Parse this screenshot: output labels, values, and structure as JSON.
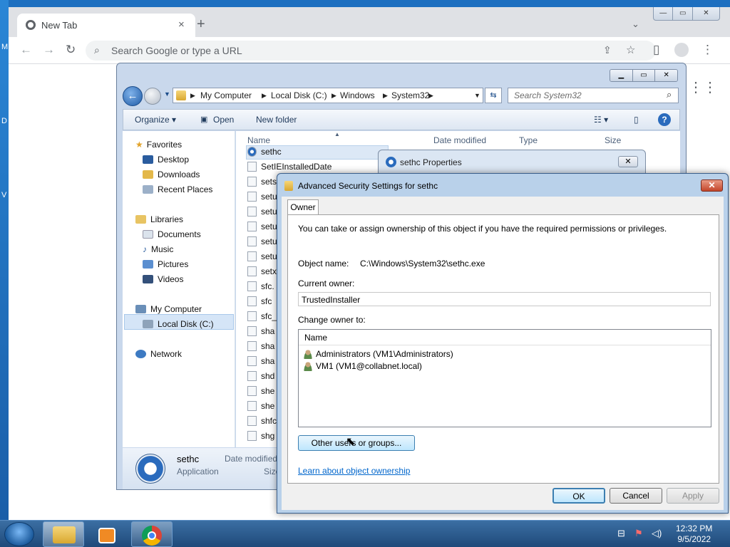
{
  "browser": {
    "tab_title": "New Tab",
    "tab_close": "×",
    "new_tab": "+",
    "tab_search": "⌄",
    "omnibox_placeholder": "Search Google or type a URL",
    "window_buttons": [
      "—",
      "▭",
      "✕"
    ]
  },
  "explorer": {
    "breadcrumbs": [
      "My Computer",
      "Local Disk (C:)",
      "Windows",
      "System32"
    ],
    "search_placeholder": "Search System32",
    "commands": {
      "organize": "Organize ▾",
      "open": "Open",
      "new_folder": "New folder"
    },
    "nav": {
      "favorites": "Favorites",
      "desktop": "Desktop",
      "downloads": "Downloads",
      "recent": "Recent Places",
      "libraries": "Libraries",
      "documents": "Documents",
      "music": "Music",
      "pictures": "Pictures",
      "videos": "Videos",
      "computer": "My Computer",
      "local_disk": "Local Disk (C:)",
      "network": "Network"
    },
    "columns": {
      "name": "Name",
      "date": "Date modified",
      "type": "Type",
      "size": "Size"
    },
    "files": [
      "sethc",
      "SetIEInstalledDate",
      "sets",
      "setu",
      "setu",
      "setu",
      "setu",
      "setu",
      "setx",
      "sfc.",
      "sfc",
      "sfc_",
      "sha",
      "sha",
      "sha",
      "shd",
      "she",
      "she",
      "shfc",
      "shg"
    ],
    "details": {
      "name": "sethc",
      "type": "Application",
      "date_label": "Date modified",
      "size_label": "Size"
    }
  },
  "properties": {
    "title": "sethc Properties",
    "close": "✕"
  },
  "advanced": {
    "title": "Advanced Security Settings for sethc",
    "close": "✕",
    "tab": "Owner",
    "info": "You can take or assign ownership of this object if you have the required permissions or privileges.",
    "object_name_label": "Object name:",
    "object_name_value": "C:\\Windows\\System32\\sethc.exe",
    "current_owner_label": "Current owner:",
    "current_owner_value": "TrustedInstaller",
    "change_owner_label": "Change owner to:",
    "list_header": "Name",
    "owners": [
      "Administrators (VM1\\Administrators)",
      "VM1 (VM1@collabnet.local)"
    ],
    "other_users_button": "Other users or groups...",
    "learn_link": "Learn about object ownership",
    "ok": "OK",
    "cancel": "Cancel",
    "apply": "Apply"
  },
  "taskbar": {
    "time": "12:32 PM",
    "date": "9/5/2022"
  }
}
